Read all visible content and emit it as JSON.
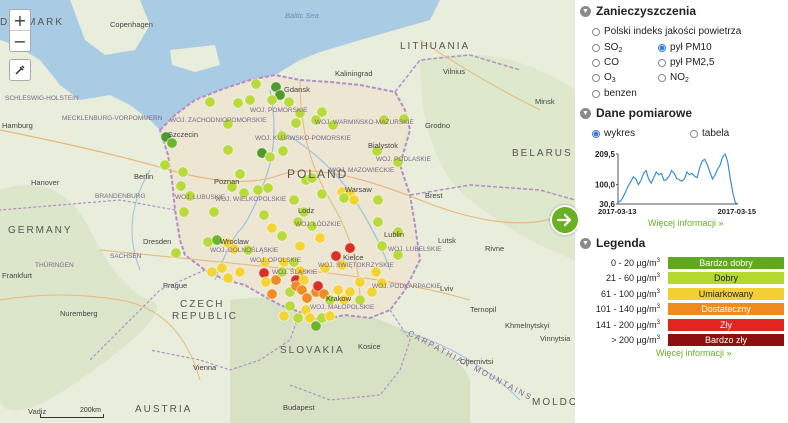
{
  "map": {
    "countries": [
      "DENMARK",
      "LITHUANIA",
      "BELARUS",
      "POLAND",
      "GERMANY",
      "CZECH",
      "REPUBLIC",
      "SLOVAKIA",
      "AUSTRIA",
      "MOLDO"
    ],
    "cities": [
      "Copenhagen",
      "Kaliningrad",
      "Vilnius",
      "Minsk",
      "Hamburg",
      "Szczecin",
      "Gdansk",
      "Bialystok",
      "Grodno",
      "Berlin",
      "Hanover",
      "Poznan",
      "Warsaw",
      "Brest",
      "Lodz",
      "Lublin",
      "Dresden",
      "Wroclaw",
      "Prague",
      "Kielce",
      "Krakow",
      "Frankfurt",
      "Nuremberg",
      "Kosice",
      "Vienna",
      "Budapest",
      "Lviv",
      "Ternopil",
      "Khmelnytskyi",
      "Vinnytsia",
      "Chernivtsi",
      "Rivne",
      "Lutsk"
    ],
    "seas": [
      "Baltic Sea"
    ],
    "regions": [
      "SCHLESWIG-HOLSTEIN",
      "MECKLENBURG-VORPOMMERN",
      "BRANDENBURG",
      "SACHSEN",
      "THÜRINGEN",
      "WOJ. POMORSKIE",
      "WOJ. ZACHODNIOPOMORSKIE",
      "WOJ. WARMIŃSKO-MAZURSKIE",
      "WOJ. KUJAWSKO-POMORSKIE",
      "WOJ. PODLASKIE",
      "WOJ. MAZOWIECKIE",
      "WOJ. LUBUSKIE",
      "WOJ. WIELKOPOLSKIE",
      "WOJ. ŁÓDZKIE",
      "WOJ. DOLNOŚLĄSKIE",
      "WOJ. OPOLSKIE",
      "WOJ. ŚLĄSKIE",
      "WOJ. ŚWIĘTOKRZYSKIE",
      "WOJ. LUBELSKIE",
      "WOJ. MAŁOPOLSKIE",
      "WOJ. PODKARPACKIE",
      "CARPATHIAN MOUNTAINS"
    ],
    "scale_label": "200km",
    "attribution": "Vadiz"
  },
  "controls": {
    "zoom_in": "+",
    "zoom_out": "−"
  },
  "panel": {
    "pollutants": {
      "title": "Zanieczyszczenia",
      "index_label": "Polski indeks jakości powietrza",
      "options": [
        {
          "label": "SO",
          "sub": "2",
          "selected": false
        },
        {
          "label": "pył PM10",
          "sub": "",
          "selected": true
        },
        {
          "label": "CO",
          "sub": "",
          "selected": false
        },
        {
          "label": "pył PM2,5",
          "sub": "",
          "selected": false
        },
        {
          "label": "O",
          "sub": "3",
          "selected": false
        },
        {
          "label": "NO",
          "sub": "2",
          "selected": false
        },
        {
          "label": "benzen",
          "sub": "",
          "selected": false
        }
      ]
    },
    "measurements": {
      "title": "Dane pomiarowe",
      "view_chart": "wykres",
      "view_table": "tabela",
      "more_info": "Więcej informacji »"
    },
    "legend": {
      "title": "Legenda",
      "rows": [
        {
          "range": "0 - 20 µg/m",
          "unit_sup": "3",
          "label": "Bardzo dobry",
          "color": "#5fa81f",
          "text_color": "#ffffff"
        },
        {
          "range": "21 - 60 µg/m",
          "unit_sup": "3",
          "label": "Dobry",
          "color": "#b4d92e",
          "text_color": "#222222"
        },
        {
          "range": "61 - 100 µg/m",
          "unit_sup": "3",
          "label": "Umiarkowany",
          "color": "#f2d034",
          "text_color": "#222222"
        },
        {
          "range": "101 - 140 µg/m",
          "unit_sup": "3",
          "label": "Dostateczny",
          "color": "#f0891e",
          "text_color": "#ffffff"
        },
        {
          "range": "141 - 200 µg/m",
          "unit_sup": "3",
          "label": "Zły",
          "color": "#e0261e",
          "text_color": "#ffffff"
        },
        {
          "range": "> 200 µg/m",
          "unit_sup": "3",
          "label": "Bardzo zły",
          "color": "#8c1010",
          "text_color": "#ffffff"
        }
      ],
      "more_info": "Więcej informacji »"
    }
  },
  "chart_data": {
    "type": "line",
    "x_start": "2017-03-13",
    "x_end": "2017-03-15",
    "y_ticks": [
      "209,5",
      "100,0",
      "30,6"
    ],
    "ylim": [
      30.6,
      209.5
    ],
    "series": [
      {
        "values": [
          36,
          42,
          55,
          75,
          95,
          110,
          128,
          120,
          100,
          115,
          140,
          150,
          120,
          105,
          125,
          145,
          135,
          140,
          115,
          118,
          130,
          150,
          140,
          122,
          118,
          112,
          120,
          145,
          135,
          140,
          130,
          125,
          160,
          185,
          190,
          170,
          145,
          120,
          135,
          155,
          170,
          200,
          209,
          180,
          120,
          70,
          35,
          31
        ]
      }
    ],
    "line_color": "#3a8fd5"
  },
  "accent": {
    "green": "#6ab023",
    "blue": "#3a7fd5"
  }
}
